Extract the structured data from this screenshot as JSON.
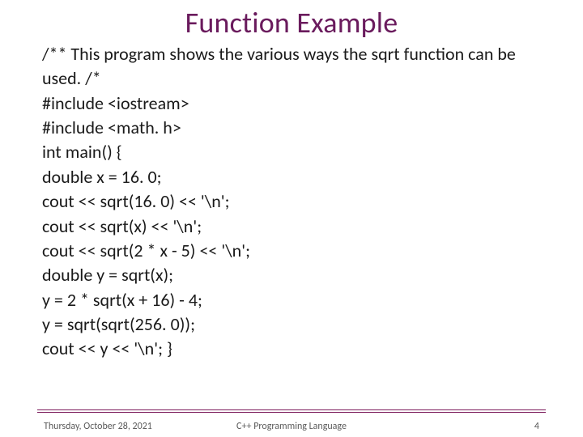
{
  "title": "Function Example",
  "code": {
    "l1": "/** This program shows the various ways the sqrt function can be used. /*",
    "l2": "#include <iostream>",
    "l3": "#include <math. h>",
    "l4": "int main() {",
    "l5": "double x = 16. 0;",
    "l6": "cout << sqrt(16. 0) << '\\n';",
    "l7": "cout << sqrt(x) << '\\n';",
    "l8": "cout << sqrt(2 * x - 5) << '\\n';",
    "l9": "double y = sqrt(x);",
    "l10": "y = 2 * sqrt(x + 16) - 4;",
    "l11": "y = sqrt(sqrt(256. 0));",
    "l12": "cout << y << '\\n'; }"
  },
  "footer": {
    "date": "Thursday, October 28, 2021",
    "course": "C++ Programming Language",
    "page": "4"
  }
}
